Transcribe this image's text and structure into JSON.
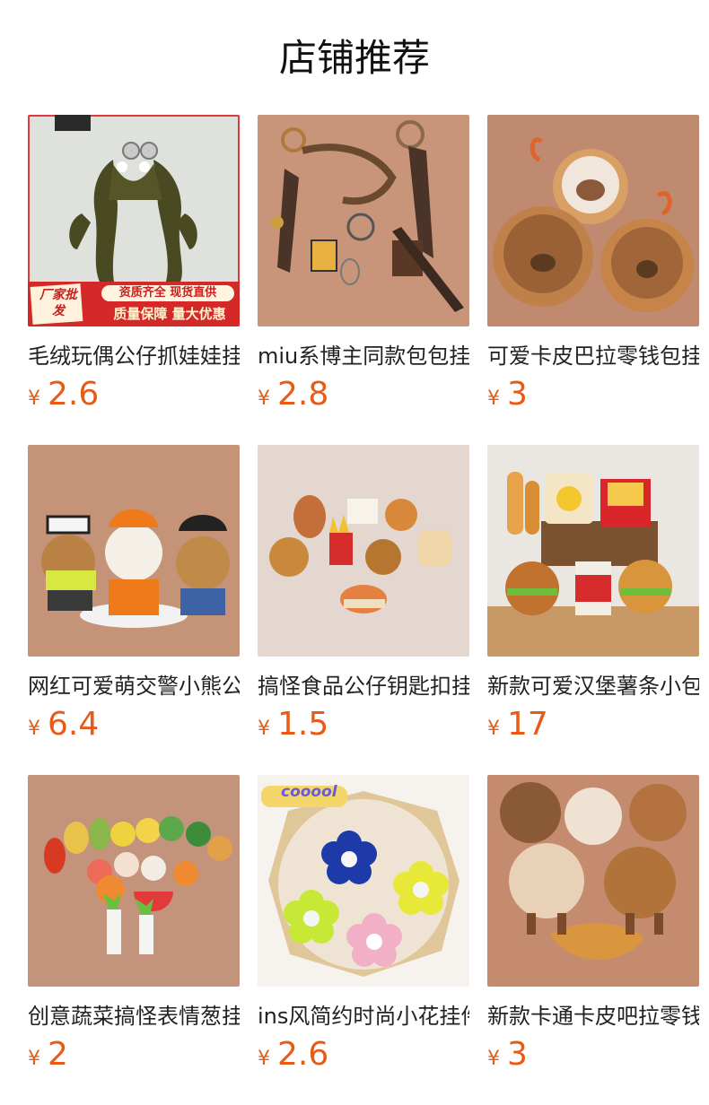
{
  "header": {
    "title": "店铺推荐"
  },
  "products": [
    {
      "name": "毛绒玩偶公仔抓娃娃挂件",
      "currency": "¥",
      "price": "2.6",
      "image_icon": "frog-plush-image",
      "promo": {
        "badge": "厂家批发",
        "line1": "资质齐全 现货直供",
        "line2": "质量保障 量大优惠"
      }
    },
    {
      "name": "miu系博主同款包包挂件",
      "currency": "¥",
      "price": "2.8",
      "image_icon": "bag-charm-image"
    },
    {
      "name": "可爱卡皮巴拉零钱包挂件",
      "currency": "¥",
      "price": "3",
      "image_icon": "capybara-coin-purse-image"
    },
    {
      "name": "网红可爱萌交警小熊公仔",
      "currency": "¥",
      "price": "6.4",
      "image_icon": "police-bear-image"
    },
    {
      "name": "搞怪食品公仔钥匙扣挂件",
      "currency": "¥",
      "price": "1.5",
      "image_icon": "food-keychain-image"
    },
    {
      "name": "新款可爱汉堡薯条小包包",
      "currency": "¥",
      "price": "17",
      "image_icon": "burger-fries-bag-image"
    },
    {
      "name": "创意蔬菜搞怪表情葱挂件",
      "currency": "¥",
      "price": "2",
      "image_icon": "vegetable-plush-image"
    },
    {
      "name": "ins风简约时尚小花挂件",
      "currency": "¥",
      "price": "2.6",
      "image_icon": "flower-charm-image",
      "sticker": "cooool"
    },
    {
      "name": "新款卡通卡皮吧拉零钱包",
      "currency": "¥",
      "price": "3",
      "image_icon": "capybara-purse-set-image"
    }
  ]
}
